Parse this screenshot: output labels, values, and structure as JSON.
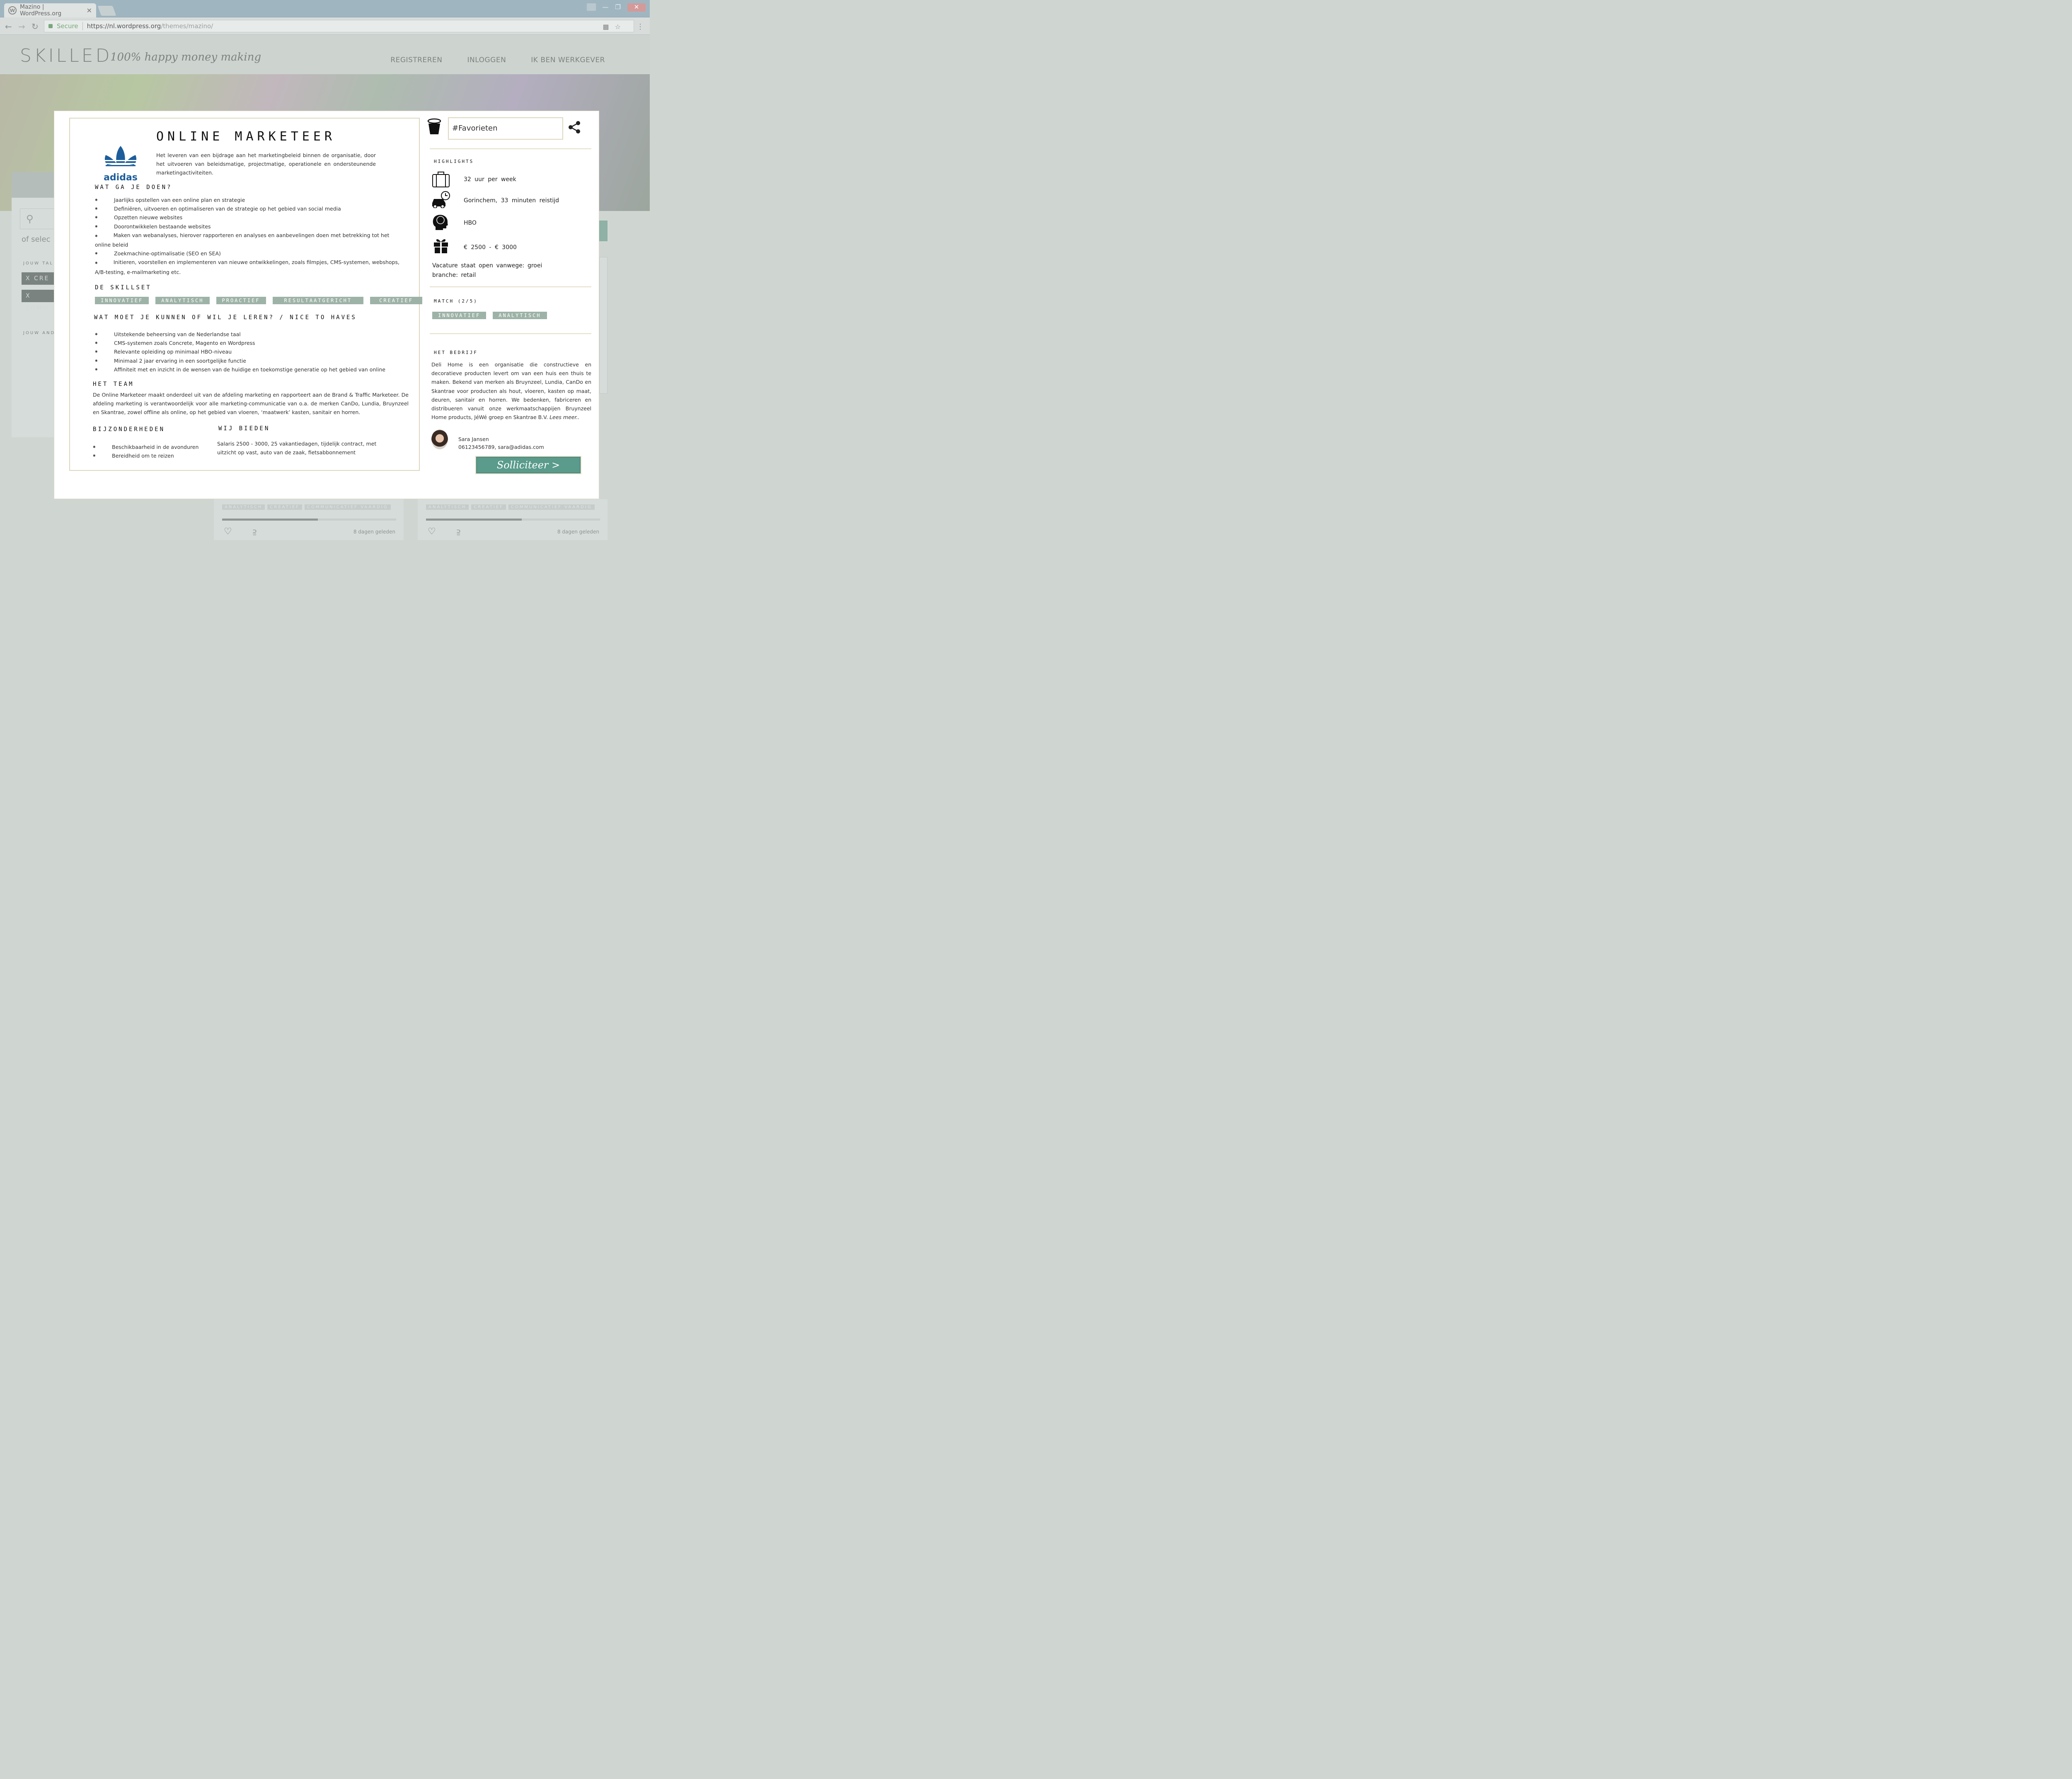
{
  "browser": {
    "tab_title": "Mazino | WordPress.org",
    "tab_close": "✕",
    "secure_label": "Secure",
    "url_host": "https://nl.wordpress.org",
    "url_path": "/themes/mazino/"
  },
  "site": {
    "logo": "SKILLED",
    "tagline": "100% happy money making",
    "nav": [
      "REGISTREREN",
      "INLOGGEN",
      "IK BEN WERKGEVER"
    ]
  },
  "background_page": {
    "search_placeholder": "of selec",
    "label_talents": "JOUW TAL",
    "chips": [
      "X CRE",
      "X COMM"
    ],
    "label_and": "JOUW AND",
    "card_tags": [
      "ANALYTISCH",
      "CREATIEF",
      "COMMUNICATIEF VAARDIG"
    ],
    "card_age": "8 dagen geleden"
  },
  "job": {
    "company_logo_text": "adidas",
    "title": "ONLINE MARKETEER",
    "intro": "Het leveren van een bijdrage aan het marketingbeleid binnen de organisatie, door het uitvoeren van beleidsmatige, projectmatige, operationele en ondersteunende marketingactiviteiten.",
    "tasks_heading": "WAT GA JE DOEN?",
    "tasks": [
      "Jaarlijks opstellen van een online plan en strategie",
      "Definiëren, uitvoeren en optimaliseren van de strategie op het gebied van social media",
      "Opzetten nieuwe websites",
      "Doorontwikkelen bestaande websites",
      "Maken van webanalyses, hierover rapporteren en analyses en aanbevelingen doen met betrekking tot het online beleid",
      "Zoekmachine-optimalisatie (SEO en SEA)",
      "Initieren, voorstellen en implementeren van nieuwe ontwikkelingen, zoals filmpjes, CMS-systemen, webshops, A/B-testing, e-mailmarketing etc."
    ],
    "skillset_heading": "DE SKILLSET",
    "skills": [
      "INNOVATIEF",
      "ANALYTISCH",
      "PROACTIEF",
      "RESULTAATGERICHT",
      "CREATIEF"
    ],
    "nice_heading": "WAT MOET JE KUNNEN OF WIL JE LEREN? / NICE TO HAVES",
    "nice": [
      "Uitstekende beheersing van de Nederlandse taal",
      "CMS-systemen zoals Concrete, Magento en Wordpress",
      "Relevante opleiding op minimaal HBO-niveau",
      "Minimaal 2 jaar ervaring in een soortgelijke functie",
      "Affiniteit met en inzicht in de wensen van de huidige en toekomstige generatie op het gebied van online"
    ],
    "team_heading": "HET TEAM",
    "team": "De Online Marketeer maakt onderdeel uit van de afdeling marketing en rapporteert aan de Brand & Traffic Marketeer. De afdeling marketing is verantwoordelijk voor alle marketing-communicatie van o.a. de merken CanDo, Lundia, Bruynzeel en Skantrae, zowel offline als online, op het gebied van vloeren, ‘maatwerk’ kasten, sanitair en horren.",
    "special_heading": "BIJZONDERHEDEN",
    "special": [
      "Beschikbaarheid in de avonduren",
      "Bereidheid om te reizen"
    ],
    "offer_heading": "WIJ BIEDEN",
    "offer": "Salaris 2500 - 3000, 25 vakantiedagen, tijdelijk contract, met uitzicht op vast, auto van de zaak, fietsabbonnement"
  },
  "sidebar": {
    "favorites_value": "#Favorieten",
    "highlights_heading": "HIGHLIGHTS",
    "highlights": [
      {
        "icon": "suitcase-icon",
        "text": "32 uur per week"
      },
      {
        "icon": "car-clock-icon",
        "text": "Gorinchem, 33 minuten reistijd"
      },
      {
        "icon": "brain-head-icon",
        "text": "HBO"
      },
      {
        "icon": "gift-icon",
        "text": "€ 2500 - € 3000"
      }
    ],
    "reason_line1": "Vacature staat open vanwege: groei",
    "reason_line2": "branche: retail",
    "match_heading": "MATCH (2/5)",
    "match_tags": [
      "INNOVATIEF",
      "ANALYTISCH"
    ],
    "company_heading": "HET BEDRIJF",
    "company_text": "Deli Home is een organisatie die constructieve en decoratieve producten levert om van een huis een thuis te maken. Bekend van merken als Bruynzeel, Lundia, CanDo en Skantrae voor producten als hout, vloeren, kasten op maat, deuren, sanitair en horren. We bedenken, fabriceren en distribueren vanuit onze werkmaatschappijen Bruynzeel Home products, JéWé groep en Skantrae B.V.",
    "read_more": "Lees meer..",
    "contact_name": "Sara Jansen",
    "contact_details": "06123456789, sara@adidas.com",
    "apply_label": "Solliciteer >"
  },
  "colors": {
    "accent": "#5a9b8b",
    "tag": "#9eb3a8",
    "border": "#ddd6bd"
  }
}
